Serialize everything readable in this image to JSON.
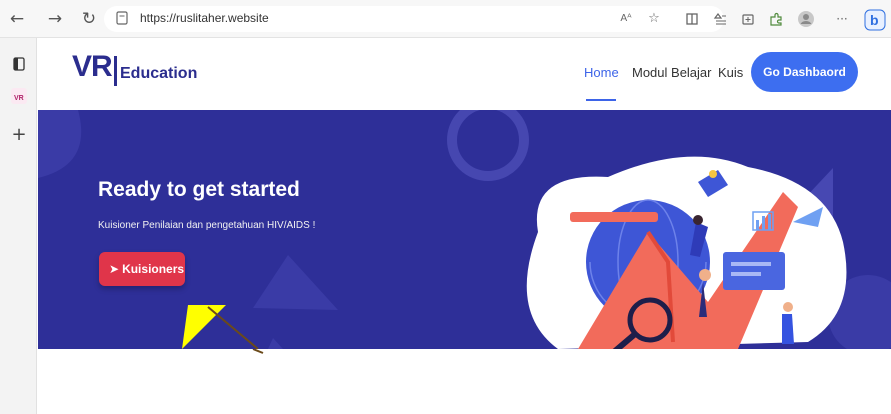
{
  "browser": {
    "url": "https://ruslitaher.website",
    "read_aloud": "Aᴬ",
    "more": "···"
  },
  "site": {
    "logo_vr": "VR",
    "logo_suffix": "Education",
    "nav": {
      "home": "Home",
      "modul": "Modul Belajar",
      "kuis": "Kuis"
    },
    "dashboard_button": "Go Dashbaord",
    "hero": {
      "title": "Ready to get started",
      "subtitle": "Kuisioner Penilaian dan pengetahuan HIV/AIDS !",
      "cta_label": "Kuisioners"
    }
  },
  "colors": {
    "hero_bg": "#2e2f98",
    "accent_blue": "#3d6ef0",
    "cta_red": "#e0354a",
    "annotation_arrow": "#ffff00"
  }
}
